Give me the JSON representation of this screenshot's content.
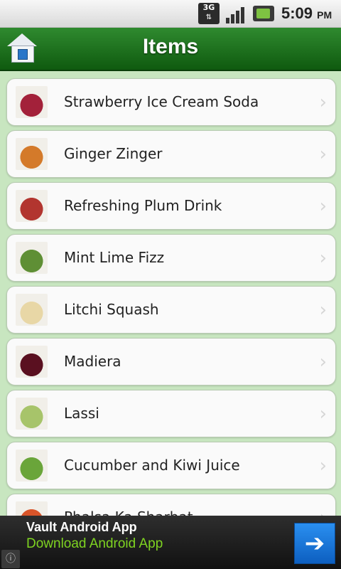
{
  "status_bar": {
    "network": "3G",
    "time": "5:09",
    "ampm": "PM"
  },
  "header": {
    "title": "Items",
    "home_icon": "home-icon"
  },
  "items": [
    {
      "label": "Strawberry Ice Cream Soda",
      "thumb_color": "#a3213a"
    },
    {
      "label": "Ginger Zinger",
      "thumb_color": "#d47a2a"
    },
    {
      "label": "Refreshing Plum Drink",
      "thumb_color": "#b2352f"
    },
    {
      "label": "Mint Lime Fizz",
      "thumb_color": "#5f8f35"
    },
    {
      "label": "Litchi Squash",
      "thumb_color": "#e8d7a6"
    },
    {
      "label": "Madiera",
      "thumb_color": "#5a1020"
    },
    {
      "label": "Lassi",
      "thumb_color": "#a7c46a"
    },
    {
      "label": "Cucumber and Kiwi Juice",
      "thumb_color": "#6aa53a"
    },
    {
      "label": "Phalsa Ka Sharbat",
      "thumb_color": "#d9552a"
    }
  ],
  "ad": {
    "title": "Vault Android App",
    "subtitle": "Download Android App",
    "arrow_icon": "arrow-right-icon",
    "info_icon": "info-icon"
  },
  "colors": {
    "header_green": "#1a6e1a",
    "background": "#c8e6c0",
    "ad_link": "#7ed321",
    "ad_button": "#1a75d9"
  }
}
